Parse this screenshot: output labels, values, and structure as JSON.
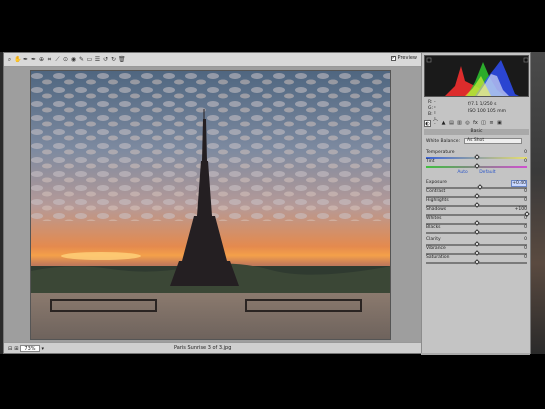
{
  "toolbar": {
    "tools": [
      "zoom-tool",
      "hand-tool",
      "white-balance-tool",
      "color-sampler-tool",
      "targeted-adjustment-tool",
      "crop-tool",
      "straighten-tool",
      "spot-removal-tool",
      "red-eye-tool",
      "adjustment-brush-tool",
      "graduated-filter-tool",
      "preferences",
      "rotate-ccw",
      "rotate-cw",
      "trash"
    ],
    "preview_label": "Preview"
  },
  "status": {
    "zoom_value": "73%",
    "filename": "Paris Sunrise 3 of 3.jpg"
  },
  "histogram": {
    "readout_left_labels": [
      "R:",
      "G:",
      "B:"
    ],
    "readout_left_values": [
      "---",
      "---",
      "---"
    ],
    "readout_right_top": "f/7.1  1/250 s",
    "readout_right_bottom": "ISO 100  105 mm"
  },
  "panel": {
    "section_title": "Basic",
    "white_balance_label": "White Balance:",
    "white_balance_value": "As Shot",
    "auto_label": "Auto",
    "default_label": "Default",
    "sliders": [
      {
        "label": "Temperature",
        "value": "0",
        "position": 0.5,
        "gradient": "temp"
      },
      {
        "label": "Tint",
        "value": "0",
        "position": 0.5,
        "gradient": "tint"
      },
      {
        "label": "Exposure",
        "value": "+0.40",
        "position": 0.53,
        "highlight": true
      },
      {
        "label": "Contrast",
        "value": "0",
        "position": 0.5
      },
      {
        "label": "Highlights",
        "value": "0",
        "position": 0.5
      },
      {
        "label": "Shadows",
        "value": "+100",
        "position": 1.0
      },
      {
        "label": "Whites",
        "value": "0",
        "position": 0.5
      },
      {
        "label": "Blacks",
        "value": "0",
        "position": 0.5
      },
      {
        "label": "Clarity",
        "value": "0",
        "position": 0.5
      },
      {
        "label": "Vibrance",
        "value": "0",
        "position": 0.5
      },
      {
        "label": "Saturation",
        "value": "0",
        "position": 0.5
      }
    ]
  },
  "colors": {
    "accent": "#2b56c8",
    "panel_bg": "#c4c4c4",
    "canvas_bg": "#9e9e9e"
  }
}
